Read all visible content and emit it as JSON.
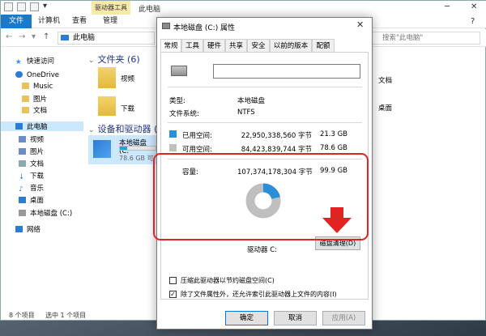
{
  "explorer": {
    "title": "此电脑",
    "context_tab": "驱动器工具",
    "ribbon_tabs": [
      "文件",
      "计算机",
      "查看",
      "管理"
    ],
    "address": "此电脑",
    "search_placeholder": "搜索\"此电脑\"",
    "nav": {
      "quick_access": "快速访问",
      "onedrive": "OneDrive",
      "music": "Music",
      "pictures1": "图片",
      "documents1": "文档",
      "this_pc": "此电脑",
      "videos": "视频",
      "pictures2": "图片",
      "documents2": "文档",
      "downloads": "下载",
      "music2": "音乐",
      "desktop": "桌面",
      "local_disk": "本地磁盘 (C:)",
      "network": "网络"
    },
    "groups": {
      "folders": "文件夹 (6)",
      "drives": "设备和驱动器 (2)"
    },
    "folders": {
      "videos": "视频",
      "downloads": "下载",
      "documents": "文档",
      "desktop": "桌面"
    },
    "drive_tile": {
      "label": "本地磁盘 (C:",
      "free": "78.6 GB 可"
    },
    "status": {
      "count": "8 个项目",
      "selected": "选中 1 个项目"
    }
  },
  "dialog": {
    "title": "本地磁盘 (C:) 属性",
    "tabs": [
      "常规",
      "工具",
      "硬件",
      "共享",
      "安全",
      "以前的版本",
      "配额"
    ],
    "name_value": "",
    "type_label": "类型:",
    "type_value": "本地磁盘",
    "fs_label": "文件系统:",
    "fs_value": "NTFS",
    "used_label": "已用空间:",
    "used_bytes": "22,950,338,560 字节",
    "used_gb": "21.3 GB",
    "free_label": "可用空间:",
    "free_bytes": "84,423,839,744 字节",
    "free_gb": "78.6 GB",
    "capacity_label": "容量:",
    "capacity_bytes": "107,374,178,304 字节",
    "capacity_gb": "99.9 GB",
    "drive_label": "驱动器 C:",
    "cleanup_button": "磁盘清理(D)",
    "compress_label": "压缩此驱动器以节约磁盘空间(C)",
    "index_label": "除了文件属性外，还允许索引此驱动器上文件的内容(I)",
    "compress_checked": false,
    "index_checked": true,
    "ok": "确定",
    "cancel": "取消",
    "apply": "应用(A)",
    "used_fraction": 0.214,
    "colors": {
      "used": "#2a8fd8",
      "free": "#bfbfbf",
      "highlight": "#e32222",
      "arrow": "#e32222"
    }
  }
}
